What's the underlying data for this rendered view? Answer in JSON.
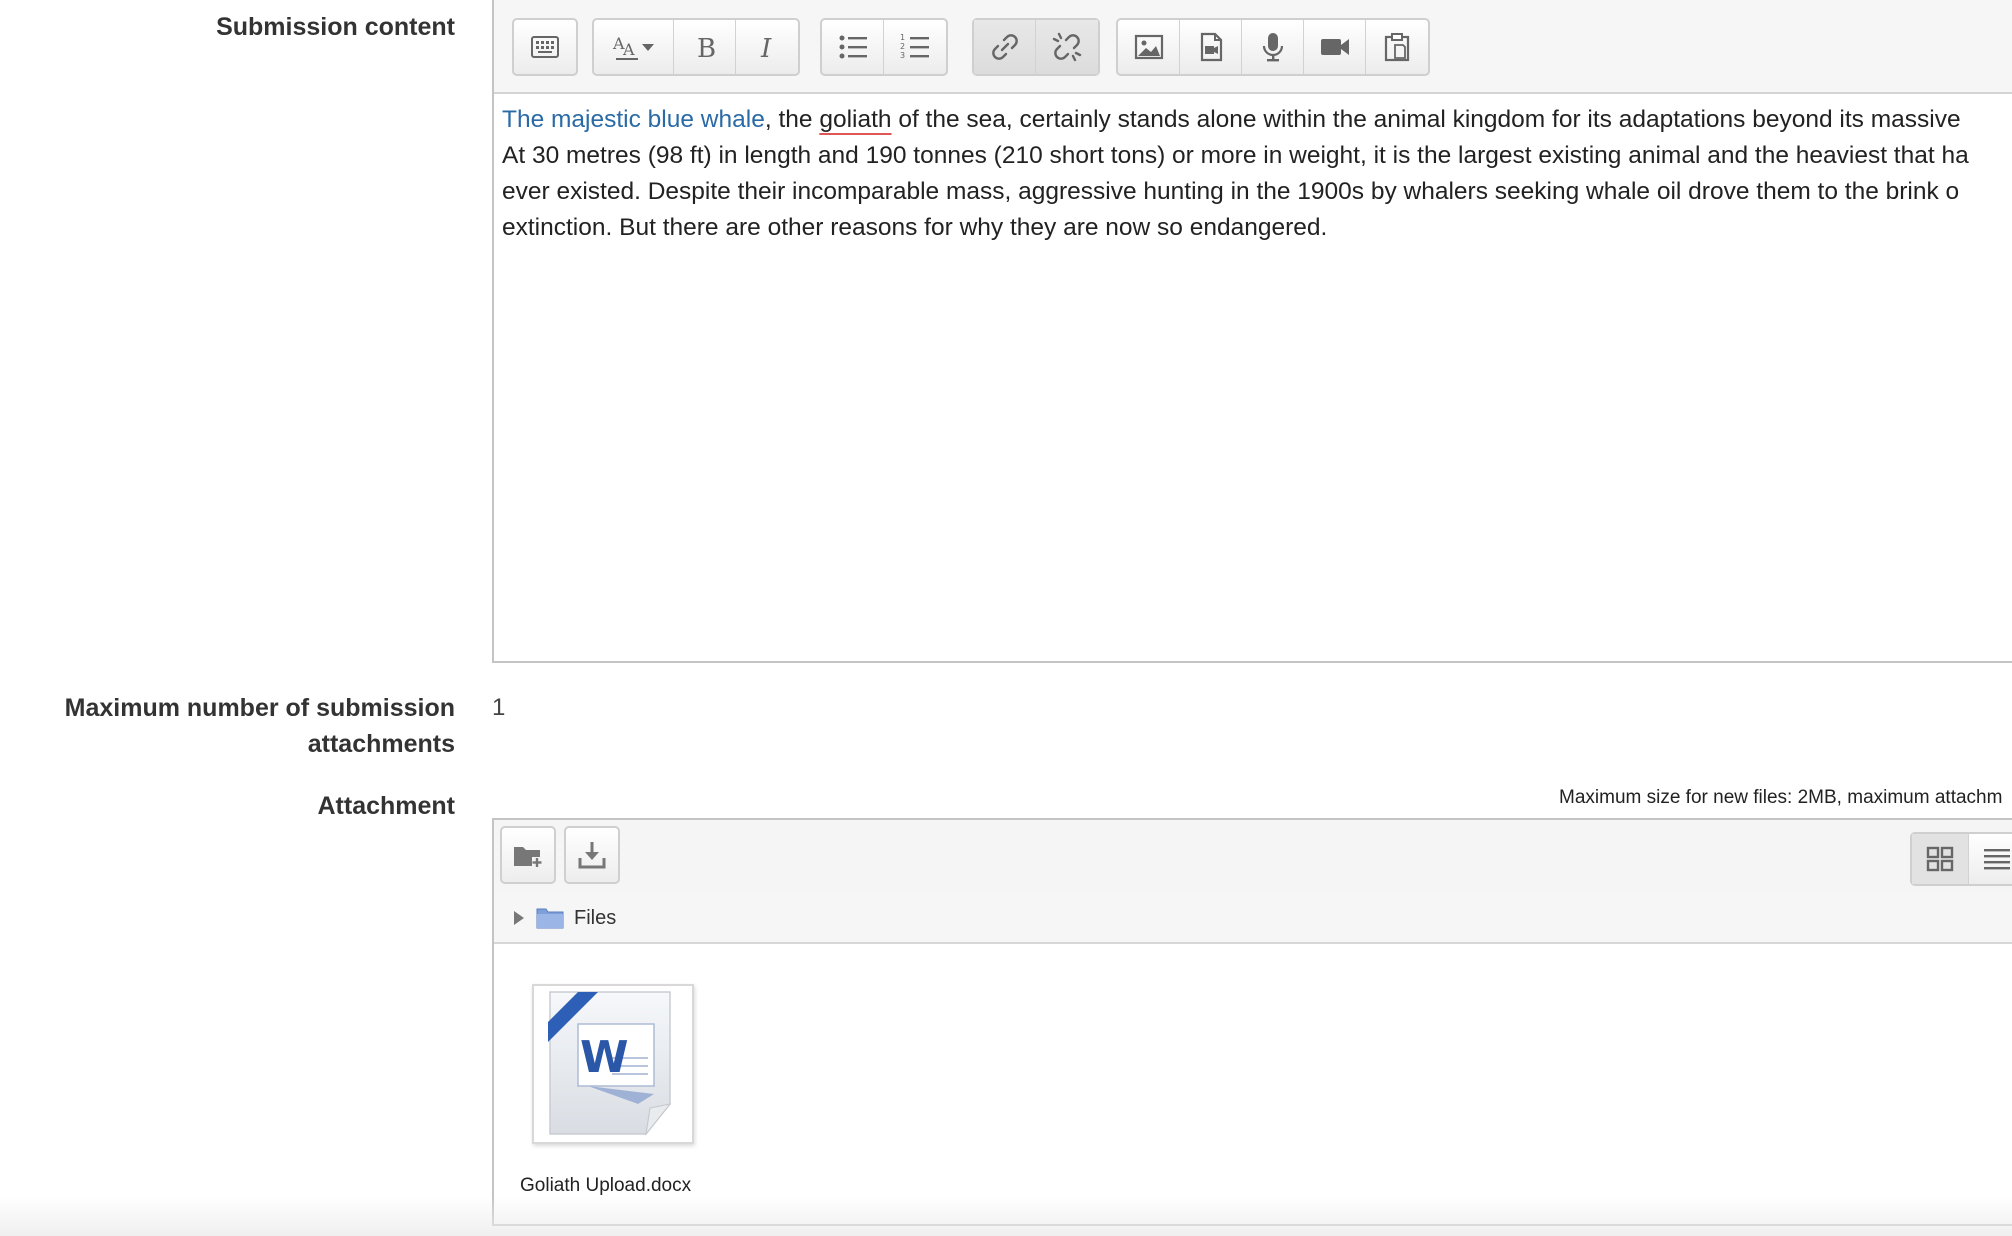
{
  "labels": {
    "submission_content": "Submission content",
    "max_attachments_line1": "Maximum number of submission",
    "max_attachments_line2": "attachments",
    "attachment": "Attachment"
  },
  "editor": {
    "toolbar_icons": [
      "show-more-icon",
      "font-size-icon",
      "bold-icon",
      "italic-icon",
      "unordered-list-icon",
      "ordered-list-icon",
      "link-icon",
      "unlink-icon",
      "image-icon",
      "media-icon",
      "microphone-icon",
      "video-icon",
      "paste-icon"
    ],
    "content": {
      "link_text": "The majestic blue whale",
      "line1_part1": ", the ",
      "misspelled_word": "goliath",
      "line1_part2": " of the sea, certainly stands alone within the animal kingdom for its adaptations beyond its massive",
      "line2": "At 30 metres (98 ft) in length and 190 tonnes (210 short tons) or more in weight, it is the largest existing animal and the heaviest that ha",
      "line3": "ever existed. Despite their incomparable mass, aggressive hunting in the 1900s by whalers seeking whale oil drove them to the brink o",
      "line4": "extinction. But there are other reasons for why they are now so endangered."
    },
    "link_color": "#2a6aa5"
  },
  "max_attachments_value": "1",
  "file_limits_text": "Maximum size for new files: 2MB, maximum attachm",
  "filemanager": {
    "path_label": "Files",
    "file_name": "Goliath Upload.docx",
    "file_icon": "word-document-icon",
    "view_modes": [
      "grid-view-icon",
      "list-view-icon"
    ]
  }
}
